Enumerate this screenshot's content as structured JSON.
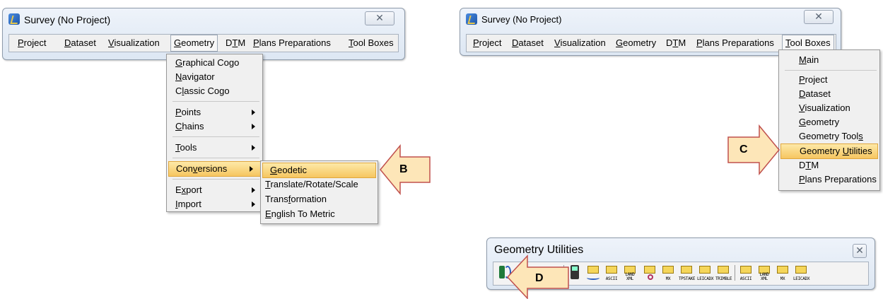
{
  "window_left": {
    "title": "Survey (No Project)",
    "menu": [
      "Project",
      "Dataset",
      "Visualization",
      "Geometry",
      "DTM",
      "Plans Preparations",
      "Tool Boxes"
    ]
  },
  "geometry_menu": {
    "items": [
      "Graphical Cogo",
      "Navigator",
      "Classic Cogo",
      "Points",
      "Chains",
      "Tools",
      "Conversions",
      "Export",
      "Import"
    ]
  },
  "conversions_submenu": {
    "items": [
      "Geodetic",
      "Translate/Rotate/Scale",
      "Transformation",
      "English To Metric"
    ]
  },
  "window_right": {
    "title": "Survey (No Project)",
    "menu": [
      "Project",
      "Dataset",
      "Visualization",
      "Geometry",
      "DTM",
      "Plans Preparations",
      "Tool Boxes"
    ]
  },
  "toolboxes_menu": {
    "items": [
      "Main",
      "Project",
      "Dataset",
      "Visualization",
      "Geometry",
      "Geometry Tools",
      "Geometry Utilities",
      "DTM",
      "Plans Preparations"
    ]
  },
  "geometry_utilities": {
    "title": "Geometry Utilities",
    "icon_labels": [
      "ASCII",
      "LAND XML",
      "MX",
      "TPSTAKE",
      "LEICADX",
      "TRIMBLE",
      "ASCII",
      "LAND XML",
      "MX",
      "LEICADX"
    ]
  },
  "callouts": {
    "b": "B",
    "c": "C",
    "d": "D"
  },
  "colors": {
    "highlight": "#f6c660",
    "callout_fill": "#fde6b8",
    "callout_stroke": "#c0504d"
  }
}
